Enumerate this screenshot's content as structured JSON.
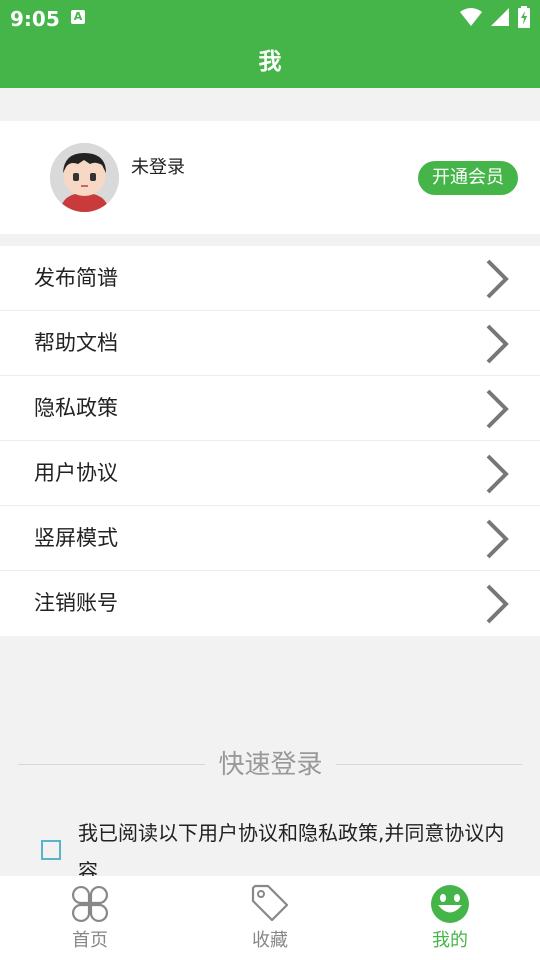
{
  "status_bar": {
    "time": "9:05",
    "notification_badge": "A"
  },
  "header": {
    "title": "我"
  },
  "profile": {
    "name": "未登录",
    "member_button": "开通会员"
  },
  "menu": [
    {
      "label": "发布简谱"
    },
    {
      "label": "帮助文档"
    },
    {
      "label": "隐私政策"
    },
    {
      "label": "用户协议"
    },
    {
      "label": "竖屏模式"
    },
    {
      "label": "注销账号"
    }
  ],
  "quick_login": {
    "title": "快速登录"
  },
  "agreement": {
    "text": "我已阅读以下用户协议和隐私政策,并同意协议内容"
  },
  "tabbar": {
    "tabs": [
      {
        "label": "首页",
        "icon": "clover-icon"
      },
      {
        "label": "收藏",
        "icon": "tag-icon"
      },
      {
        "label": "我的",
        "icon": "smiley-icon",
        "active": true
      }
    ]
  },
  "colors": {
    "accent": "#46b549",
    "background": "#f2f2f2"
  }
}
